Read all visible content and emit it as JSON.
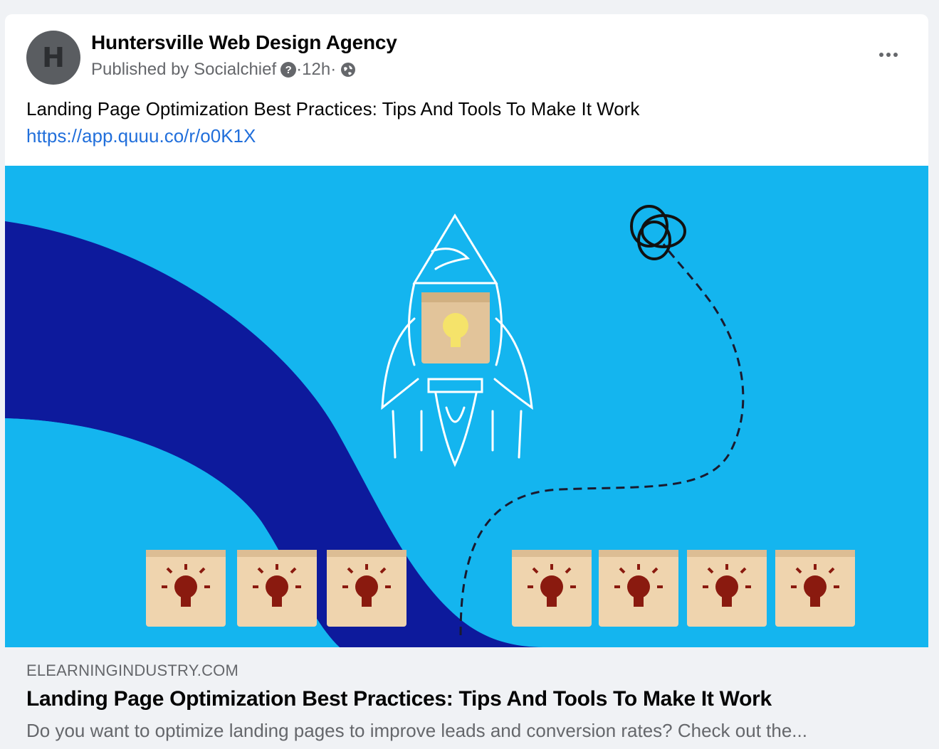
{
  "post": {
    "author": {
      "avatar_letter": "H",
      "name": "Huntersville Web Design Agency"
    },
    "meta": {
      "published_by": "Published by Socialchief",
      "separator1": " · ",
      "time": "12h",
      "separator2": " · "
    },
    "text": "Landing Page Optimization Best Practices: Tips And Tools To Make It Work",
    "link": "https://app.quuu.co/r/o0K1X",
    "more_icon": "more-horizontal-icon"
  },
  "link_preview": {
    "domain": "ELEARNINGINDUSTRY.COM",
    "title": "Landing Page Optimization Best Practices: Tips And Tools To Make It Work",
    "description": "Do you want to optimize landing pages to improve leads and conversion rates? Check out the..."
  },
  "colors": {
    "background": "#f0f2f5",
    "card": "#ffffff",
    "link": "#216fdb",
    "secondary_text": "#65676b",
    "image_sky": "#14b5ef",
    "image_band": "#0d1a9c"
  }
}
